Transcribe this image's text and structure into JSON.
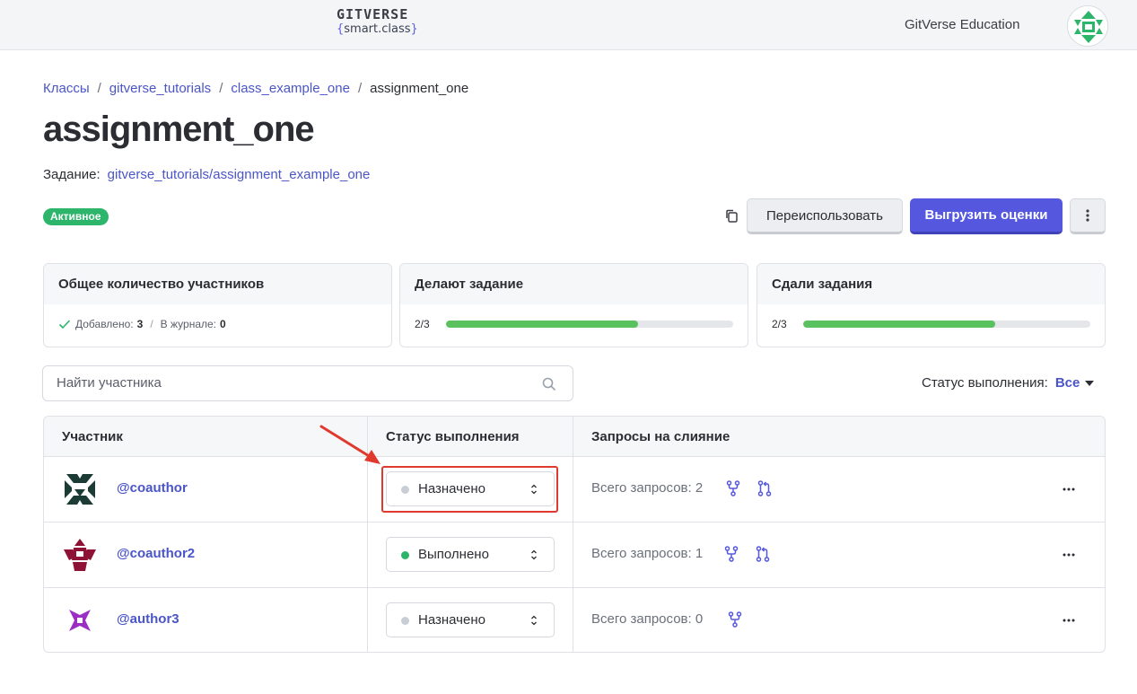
{
  "header": {
    "logo_main": "GITVERSE",
    "logo_sub_open": "{",
    "logo_sub_text": "smart.class",
    "logo_sub_close": "}",
    "org_name": "GitVerse Education",
    "avatar_icon": "identicon-green"
  },
  "breadcrumb": {
    "items": [
      {
        "label": "Классы"
      },
      {
        "label": "gitverse_tutorials"
      },
      {
        "label": "class_example_one"
      }
    ],
    "separator": "/",
    "current": "assignment_one"
  },
  "page": {
    "title": "assignment_one",
    "assignment_label": "Задание:",
    "assignment_link": "gitverse_tutorials/assignment_example_one",
    "status_badge": "Активное"
  },
  "toolbar": {
    "copy_icon": "copy-icon",
    "reuse_label": "Переиспользовать",
    "export_label": "Выгрузить оценки",
    "more_icon": "vertical-dots-icon"
  },
  "stats": [
    {
      "title": "Общее количество участников",
      "added_label": "Добавлено:",
      "added_value": "3",
      "separator": "/",
      "journal_label": "В журнале:",
      "journal_value": "0"
    },
    {
      "title": "Делают задание",
      "progress_text": "2/3",
      "progress_fraction": 0.67
    },
    {
      "title": "Сдали задания",
      "progress_text": "2/3",
      "progress_fraction": 0.67
    }
  ],
  "search": {
    "placeholder": "Найти участника",
    "value": ""
  },
  "filter": {
    "label": "Статус выполнения:",
    "value": "Все"
  },
  "table": {
    "columns": [
      "Участник",
      "Статус выполнения",
      "Запросы на слияние"
    ],
    "rows": [
      {
        "username": "@coauthor",
        "status": "Назначено",
        "status_color": "#c9ced6",
        "pr_text": "Всего запросов: 2",
        "avatar_color": "#1b3b34",
        "icons": [
          "fork-icon",
          "pull-request-icon"
        ],
        "highlighted": true
      },
      {
        "username": "@coauthor2",
        "status": "Выполнено",
        "status_color": "#2db56c",
        "pr_text": "Всего запросов: 1",
        "avatar_color": "#8e1236",
        "icons": [
          "fork-icon",
          "pull-request-icon"
        ],
        "highlighted": false
      },
      {
        "username": "@author3",
        "status": "Назначено",
        "status_color": "#c9ced6",
        "pr_text": "Всего запросов: 0",
        "avatar_color": "#9b2fc4",
        "icons": [
          "fork-icon"
        ],
        "highlighted": false
      }
    ]
  },
  "colors": {
    "accent": "#5558de",
    "link": "#4a55c7",
    "success": "#2db56c",
    "progress": "#5ac15f",
    "annotation": "#e0392d"
  }
}
